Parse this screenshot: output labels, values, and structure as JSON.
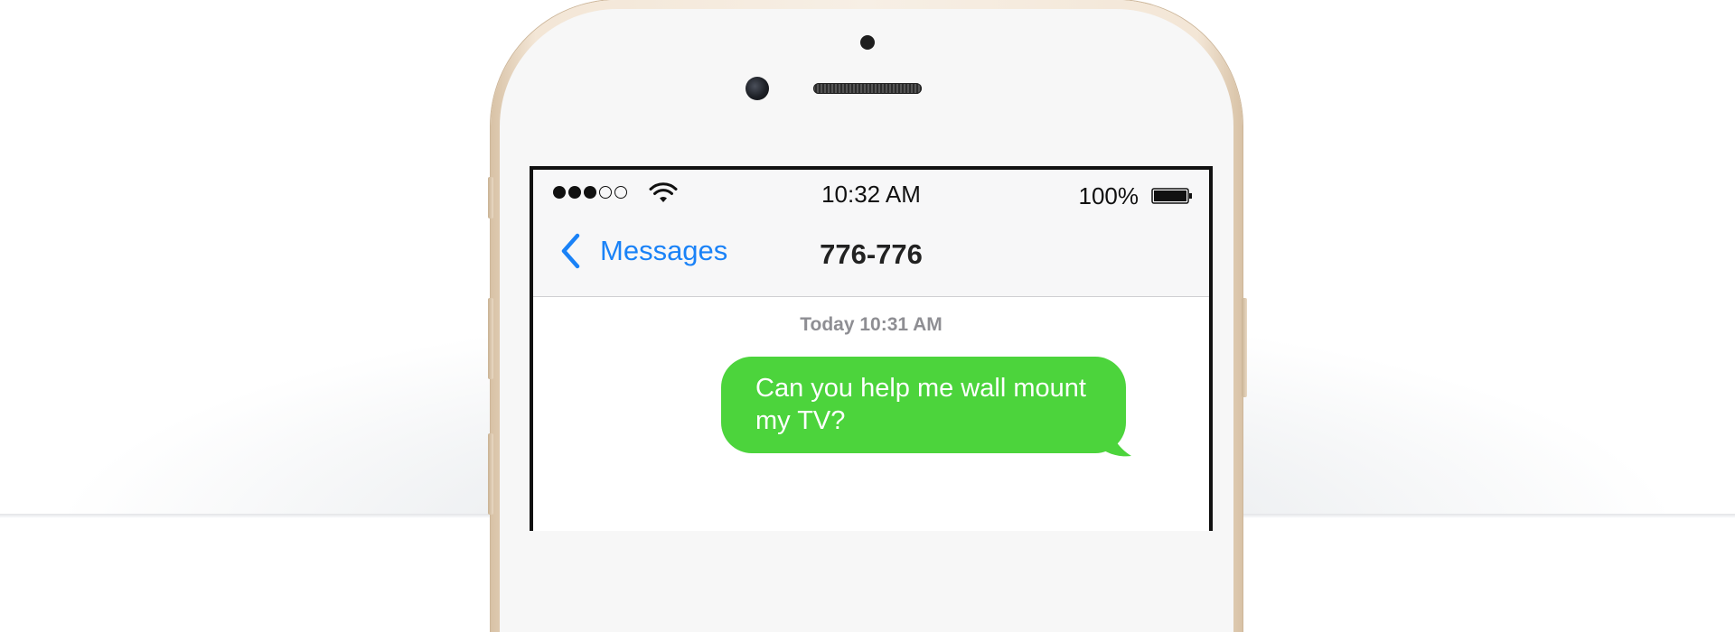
{
  "status_bar": {
    "signal_filled": 3,
    "signal_total": 5,
    "time": "10:32 AM",
    "battery_percent": "100%",
    "battery_level": 1.0,
    "wifi_icon": "wifi-icon",
    "battery_icon": "battery-icon"
  },
  "nav": {
    "back_label": "Messages",
    "back_icon": "chevron-left-icon",
    "title": "776-776"
  },
  "conversation": {
    "timestamp": "Today 10:31 AM",
    "messages": [
      {
        "direction": "sent",
        "text": "Can you help me wall mount my TV?"
      }
    ]
  },
  "colors": {
    "sent_bubble": "#4cd43c",
    "link_blue": "#1a82f7",
    "phone_frame": "#f3e6d6"
  }
}
